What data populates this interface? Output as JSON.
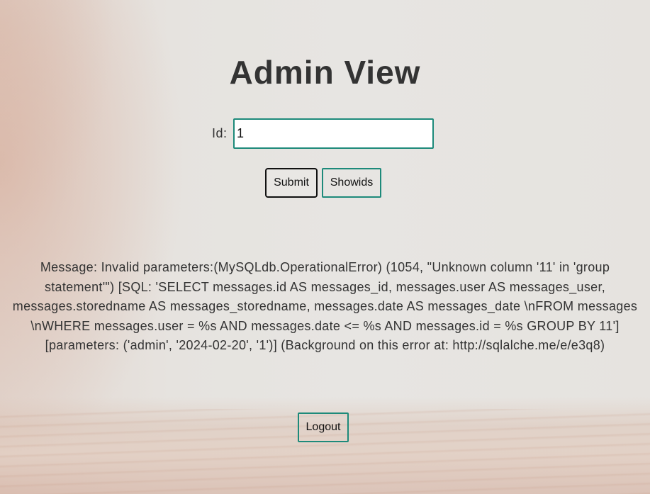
{
  "page": {
    "title": "Admin View"
  },
  "form": {
    "id_label": "Id:",
    "id_value": "1",
    "submit_label": "Submit",
    "showids_label": "Showids"
  },
  "message": {
    "text": "Message: Invalid parameters:(MySQLdb.OperationalError) (1054, \"Unknown column '11' in 'group statement'\") [SQL: 'SELECT messages.id AS messages_id, messages.user AS messages_user, messages.storedname AS messages_storedname, messages.date AS messages_date \\nFROM messages \\nWHERE messages.user = %s AND messages.date <= %s AND messages.id = %s GROUP BY 11'] [parameters: ('admin', '2024-02-20', '1')] (Background on this error at: http://sqlalche.me/e/e3q8)"
  },
  "footer": {
    "logout_label": "Logout"
  },
  "colors": {
    "text": "#333333",
    "accent_border": "#1d8a7a",
    "focused_border": "#111111"
  }
}
